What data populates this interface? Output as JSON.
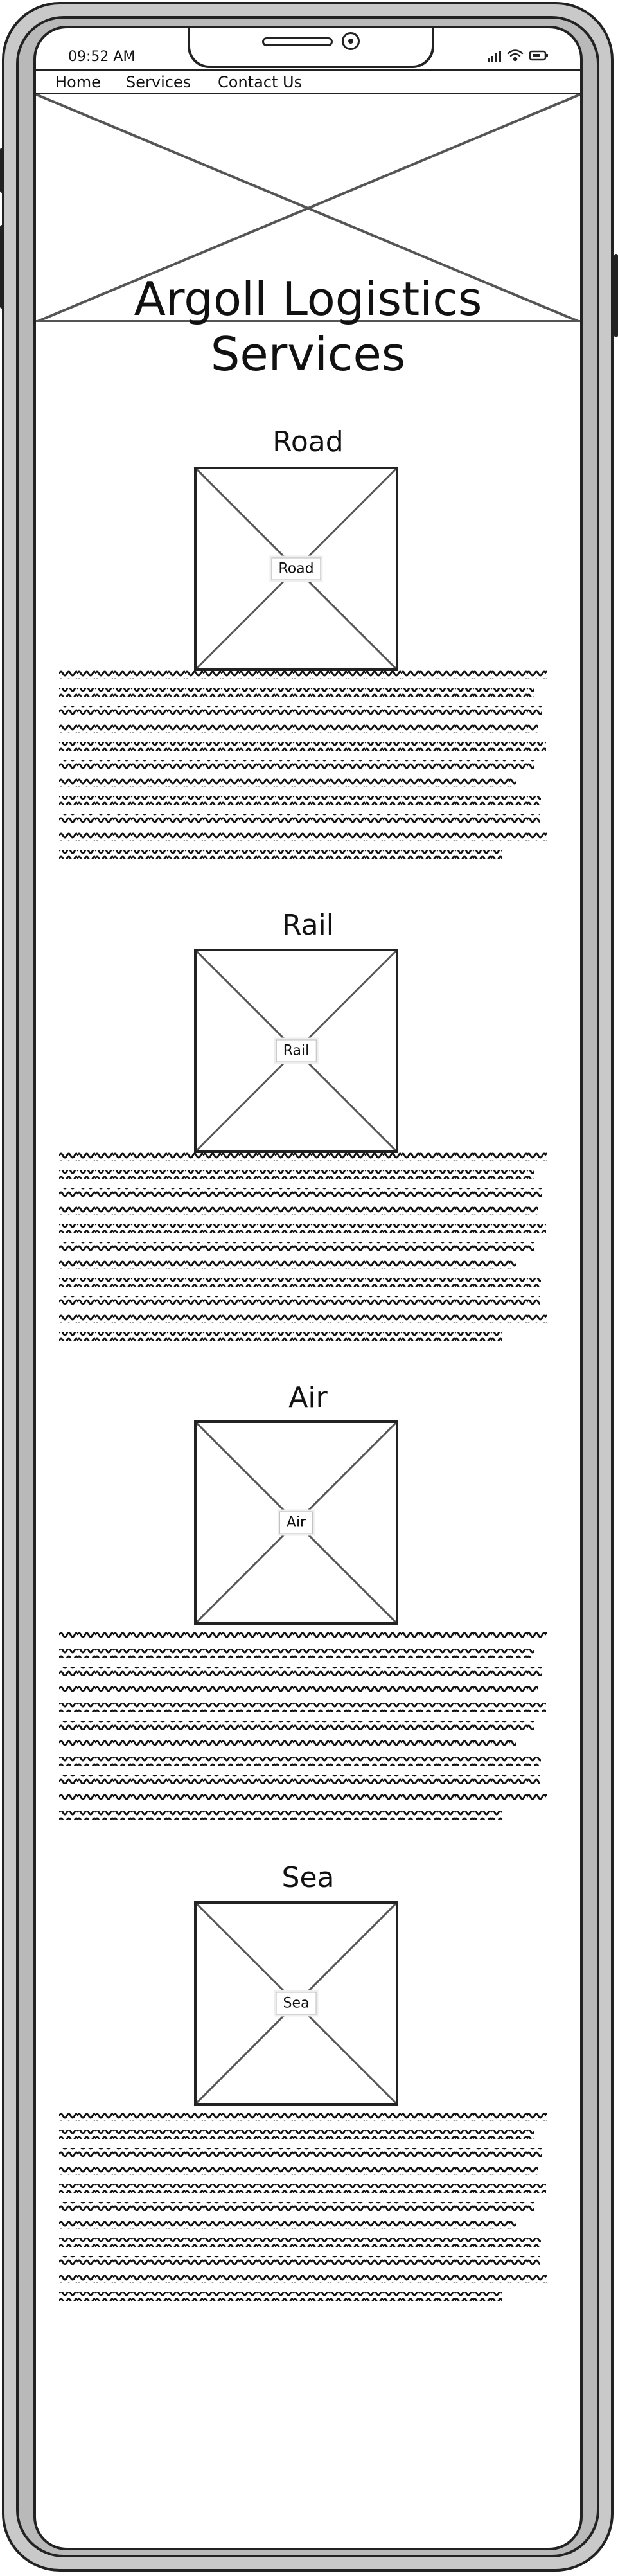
{
  "status_bar": {
    "time": "09:52 AM"
  },
  "nav": {
    "items": [
      "Home",
      "Services",
      "Contact Us"
    ]
  },
  "page": {
    "title_line1": "Argoll Logistics",
    "title_line2": "Services"
  },
  "sections": [
    {
      "title": "Road",
      "image_label": "Road"
    },
    {
      "title": "Rail",
      "image_label": "Rail"
    },
    {
      "title": "Air",
      "image_label": "Air"
    },
    {
      "title": "Sea",
      "image_label": "Sea"
    }
  ]
}
